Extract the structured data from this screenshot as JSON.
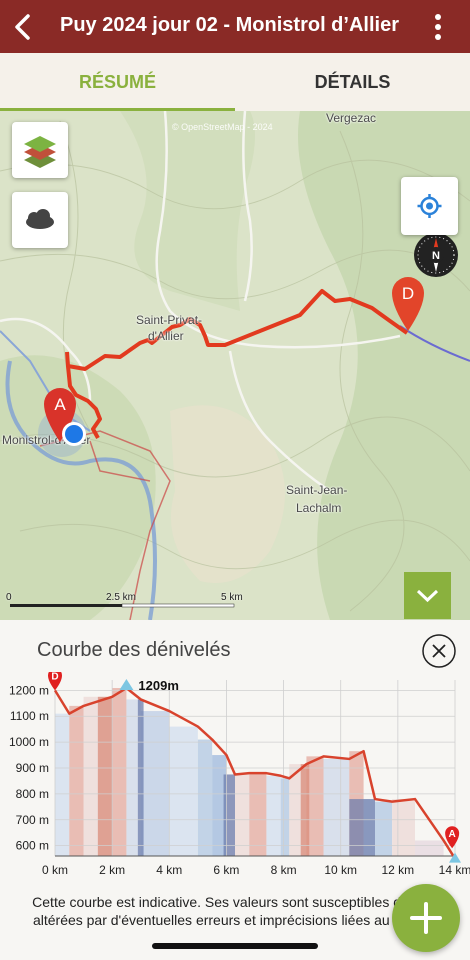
{
  "header": {
    "title": "Puy 2024 jour 02 - Monistrol d’Allier",
    "back_icon": "chevron-left-icon",
    "menu_icon": "more-vertical-icon"
  },
  "tabs": [
    {
      "label": "RÉSUMÉ",
      "active": true
    },
    {
      "label": "DÉTAILS",
      "active": false
    }
  ],
  "map": {
    "attribution": "© OpenStreetMap - 2024",
    "places": [
      "Vergezac",
      "Saint-Privat-",
      "d'Allier",
      "Monistrol-d'Allier",
      "Saint-Jean-",
      "Lachalm"
    ],
    "start_marker": "A",
    "end_marker": "D",
    "scale": {
      "zero": "0",
      "mid": "2.5 km",
      "end": "5 km"
    },
    "route_color": "#e23a1f"
  },
  "panel": {
    "title": "Courbe des dénivelés",
    "peak_label": "1209m",
    "note": "Cette courbe est indicative. Ses valeurs sont susceptibles d'être altérées par d'éventuelles erreurs et imprécisions liées au GPS."
  },
  "chart_data": {
    "type": "area",
    "x": [
      0,
      0.5,
      1,
      2,
      2.5,
      3,
      4,
      5,
      5.5,
      6,
      6.3,
      6.8,
      7.4,
      7.9,
      8.2,
      8.8,
      9.4,
      10.3,
      10.8,
      11.2,
      11.8,
      12.6,
      13.6,
      14
    ],
    "y": [
      1200,
      1110,
      1140,
      1175,
      1209,
      1165,
      1120,
      1060,
      1010,
      950,
      875,
      880,
      880,
      870,
      860,
      915,
      945,
      935,
      965,
      780,
      770,
      780,
      620,
      550
    ],
    "x_ticks": [
      "0 km",
      "2 km",
      "4 km",
      "6 km",
      "8 km",
      "10 km",
      "12 km",
      "14 km"
    ],
    "y_ticks": [
      "600 m",
      "700 m",
      "800 m",
      "900 m",
      "1000 m",
      "1100 m",
      "1200 m"
    ],
    "xlim": [
      0,
      14
    ],
    "ylim": [
      560,
      1240
    ],
    "markers": {
      "start": "D",
      "end": "A"
    },
    "line_color": "#d8432d"
  },
  "colors": {
    "brand": "#8a2a26",
    "accent": "#8ab13e"
  }
}
